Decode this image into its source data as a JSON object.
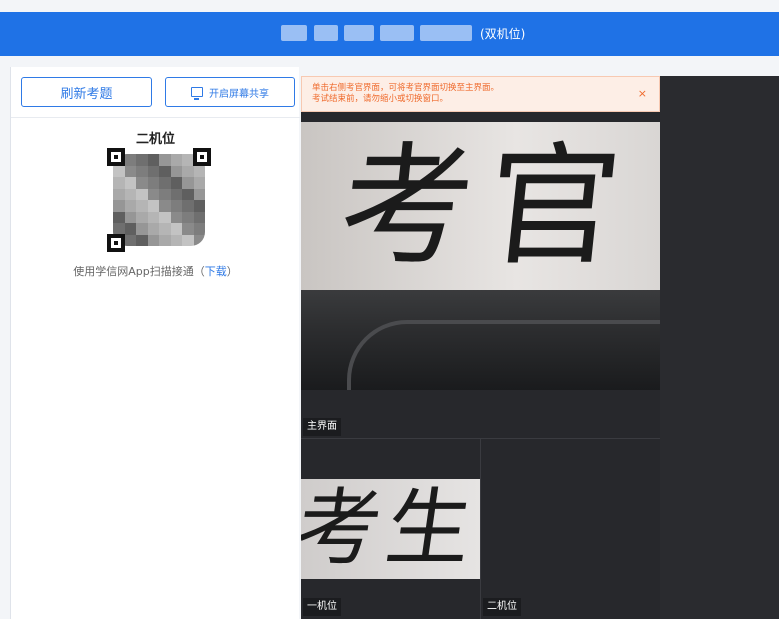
{
  "header": {
    "title": "(双机位)"
  },
  "toolbar": {
    "refresh_label": "刷新考题",
    "share_label": "开启屏幕共享"
  },
  "qr": {
    "title": "二机位",
    "hint_text": "使用学信网App扫描接通（",
    "hint_link": "下载",
    "hint_end": "）"
  },
  "notice": {
    "line1": "单击右侧考官界面，可将考官界面切换至主界面。",
    "line2": "考试结束前，请勿缩小或切换窗口。",
    "close": "×"
  },
  "videos": {
    "main_label": "主界面",
    "main_writing": "考官",
    "cam1_label": "一机位",
    "cam1_writing": "考生",
    "cam2_label": "二机位"
  },
  "colors": {
    "brand": "#1f72e6",
    "accent": "#2f7ae6",
    "warning": "#ef6a2c"
  }
}
